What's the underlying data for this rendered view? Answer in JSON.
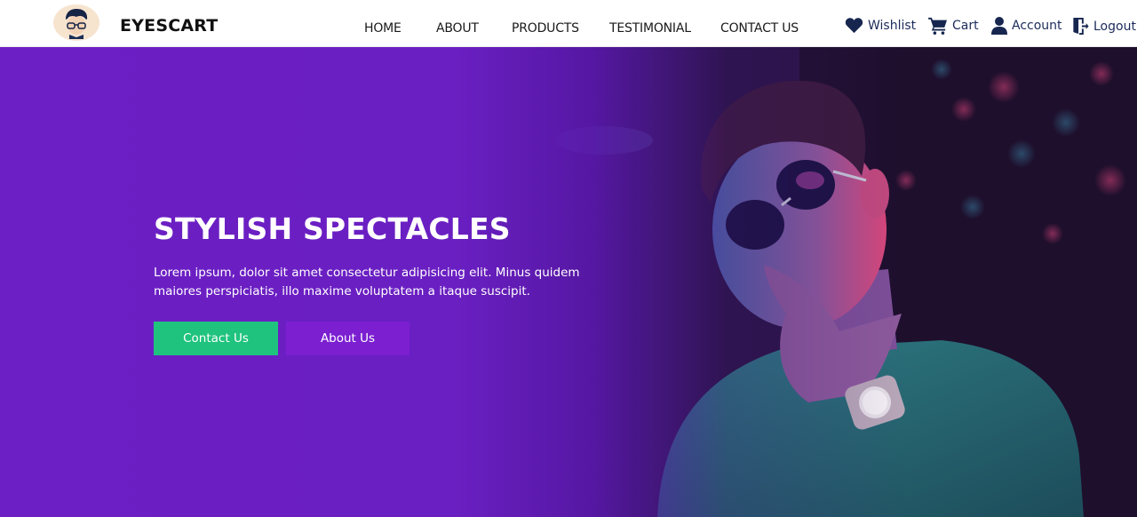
{
  "brand": {
    "name": "EYESCART",
    "logo_icon": "glasses-avatar-icon"
  },
  "nav": {
    "items": [
      {
        "label": "HOME"
      },
      {
        "label": "ABOUT"
      },
      {
        "label": "PRODUCTS"
      },
      {
        "label": "TESTIMONIAL"
      },
      {
        "label": "CONTACT US"
      }
    ]
  },
  "user_links": {
    "wishlist": {
      "label": "Wishlist",
      "icon": "heart-icon"
    },
    "cart": {
      "label": "Cart",
      "icon": "cart-icon"
    },
    "account": {
      "label": "Account",
      "icon": "user-icon"
    },
    "logout": {
      "label": "Logout",
      "icon": "door-exit-icon"
    }
  },
  "hero": {
    "title": "STYLISH SPECTACLES",
    "description": "Lorem ipsum, dolor sit amet consectetur adipisicing elit. Minus quidem maiores perspiciatis, illo maxime voluptatem a itaque suscipit.",
    "buttons": {
      "contact": "Contact Us",
      "about": "About Us"
    }
  },
  "colors": {
    "hero_purple": "#6c1fc4",
    "contact_button": "#1fc37e",
    "about_button": "#7b1fd1",
    "nav_link_user": "#1c2b5a"
  }
}
